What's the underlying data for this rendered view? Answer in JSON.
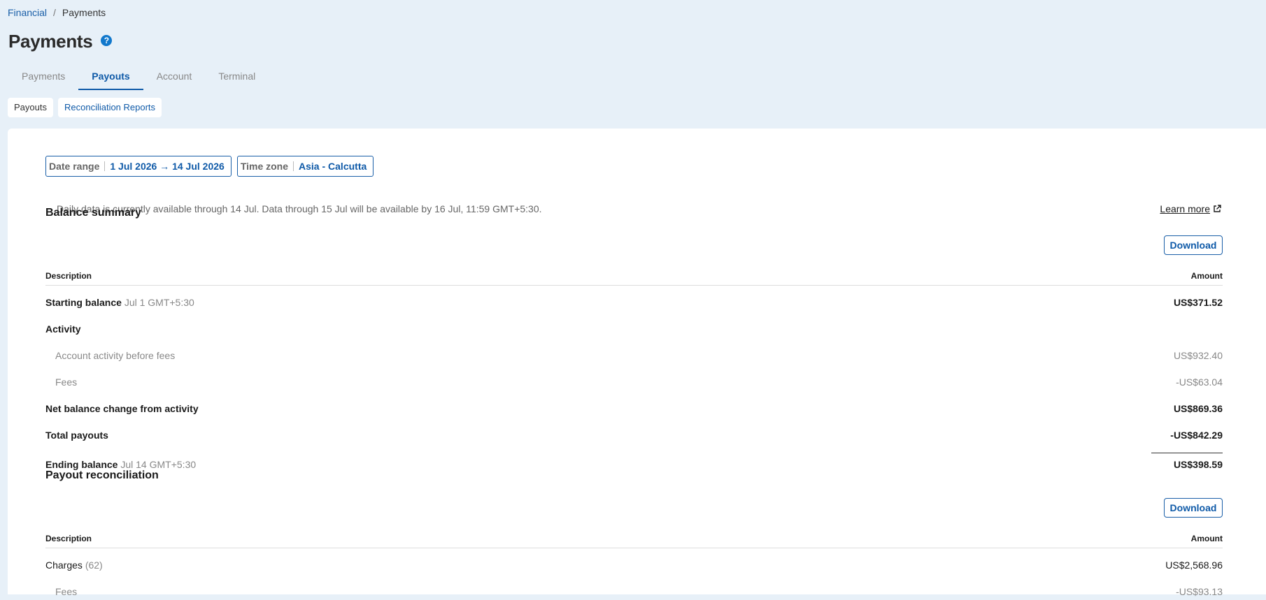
{
  "breadcrumb": {
    "parent": "Financial",
    "separator": "/",
    "current": "Payments"
  },
  "page": {
    "title": "Payments",
    "help_icon": "?"
  },
  "tabs": [
    {
      "label": "Payments",
      "active": false
    },
    {
      "label": "Payouts",
      "active": true
    },
    {
      "label": "Account",
      "active": false
    },
    {
      "label": "Terminal",
      "active": false
    }
  ],
  "subtabs": [
    {
      "label": "Payouts",
      "active": false
    },
    {
      "label": "Reconciliation Reports",
      "active": true
    }
  ],
  "filters": {
    "date_range": {
      "label": "Date range",
      "value": "1 Jul 2026 → 14 Jul 2026"
    },
    "time_zone": {
      "label": "Time zone",
      "value": "Asia - Calcutta"
    }
  },
  "notice": {
    "text": "Daily data is currently available through 14 Jul. Data through 15 Jul will be available by 16 Jul, 11:59 GMT+5:30.",
    "learn_more": "Learn more",
    "learn_more_icon": "external-link-icon"
  },
  "balance_summary": {
    "title": "Balance summary",
    "download": "Download",
    "col_description": "Description",
    "col_amount": "Amount",
    "starting": {
      "label": "Starting balance",
      "date": "Jul 1 GMT+5:30",
      "amount": "US$371.52"
    },
    "activity_label": "Activity",
    "activity_before_fees": {
      "label": "Account activity before fees",
      "amount": "US$932.40"
    },
    "fees": {
      "label": "Fees",
      "amount": "-US$63.04"
    },
    "net_change": {
      "label": "Net balance change from activity",
      "amount": "US$869.36"
    },
    "total_payouts": {
      "label": "Total payouts",
      "amount": "-US$842.29"
    },
    "ending": {
      "label": "Ending balance",
      "date": "Jul 14 GMT+5:30",
      "amount": "US$398.59"
    }
  },
  "payout_reconciliation": {
    "title": "Payout reconciliation",
    "download": "Download",
    "col_description": "Description",
    "col_amount": "Amount",
    "charges": {
      "label": "Charges",
      "count": "(62)",
      "amount": "US$2,568.96"
    },
    "fees": {
      "label": "Fees",
      "amount": "-US$93.13"
    }
  },
  "colors": {
    "accent": "#0f5aa8",
    "background": "#e7f0f8",
    "panel": "#ffffff"
  }
}
